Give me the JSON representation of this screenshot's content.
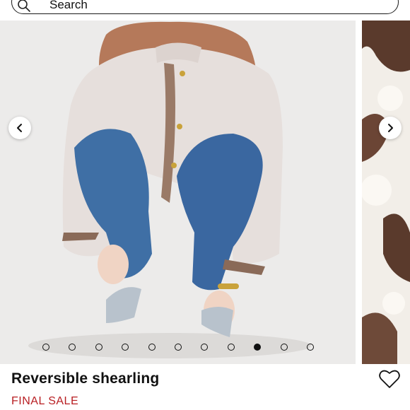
{
  "search": {
    "placeholder": "Search",
    "icon": "search-icon"
  },
  "carousel": {
    "prev_icon": "chevron-left-icon",
    "next_icon": "chevron-right-icon",
    "slide_count": 11,
    "active_index": 8
  },
  "product": {
    "title": "Reversible shearling",
    "status": "FINAL SALE",
    "status_color": "#b81e22",
    "favorite_icon": "heart-icon"
  }
}
